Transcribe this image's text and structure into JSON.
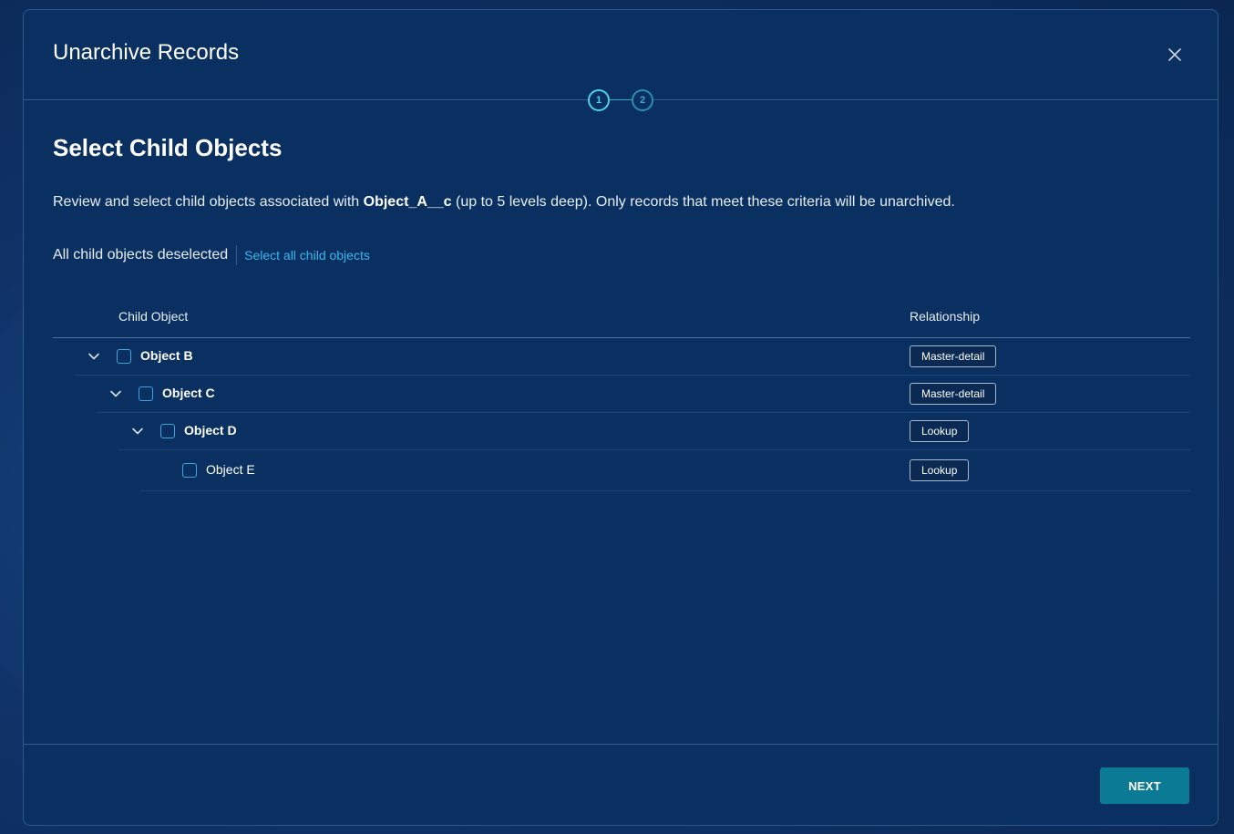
{
  "modal": {
    "title": "Unarchive Records",
    "close_icon": "close-icon"
  },
  "stepper": {
    "steps": [
      "1",
      "2"
    ],
    "active_step": 1
  },
  "section": {
    "title": "Select Child Objects",
    "description_prefix": "Review and select child objects associated with ",
    "object_name": "Object_A__c",
    "description_suffix": " (up to 5 levels deep). Only records that meet these criteria will be unarchived."
  },
  "selection": {
    "status": "All child objects deselected",
    "select_all_label": "Select all child objects"
  },
  "table": {
    "columns": {
      "child_object": "Child Object",
      "relationship": "Relationship"
    },
    "rows": [
      {
        "name": "Object B",
        "relationship": "Master-detail",
        "level": 0,
        "expanded": true,
        "checked": false
      },
      {
        "name": "Object C",
        "relationship": "Master-detail",
        "level": 1,
        "expanded": true,
        "checked": false
      },
      {
        "name": "Object D",
        "relationship": "Lookup",
        "level": 2,
        "expanded": true,
        "checked": false
      },
      {
        "name": "Object E",
        "relationship": "Lookup",
        "level": 3,
        "expanded": false,
        "checked": false
      }
    ]
  },
  "footer": {
    "next_label": "NEXT"
  },
  "colors": {
    "modal_bg": "#0a3061",
    "accent": "#4fd1e0",
    "link": "#39b6f0",
    "primary_button": "#0b7a95"
  }
}
